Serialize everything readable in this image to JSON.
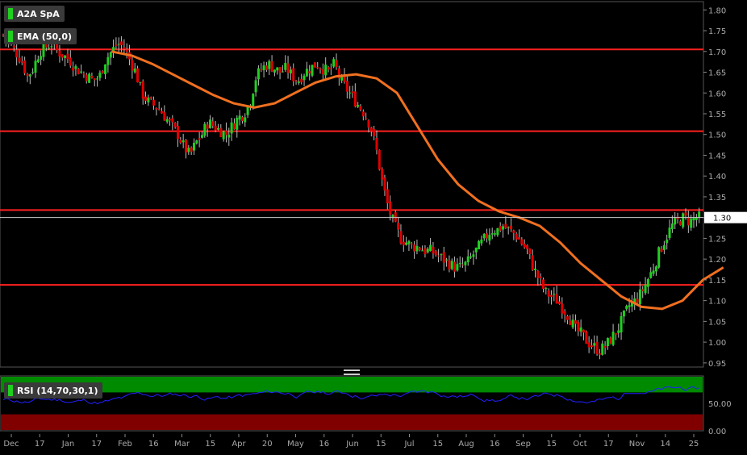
{
  "chart_data": [
    {
      "type": "candlestick",
      "title": "A2A SpA",
      "overlay": "EMA (50,0)",
      "y_ticks": [
        "1.80",
        "1.75",
        "1.70",
        "1.65",
        "1.60",
        "1.55",
        "1.50",
        "1.45",
        "1.40",
        "1.35",
        "1.30",
        "1.25",
        "1.20",
        "1.15",
        "1.10",
        "1.05",
        "1.00",
        "0.95"
      ],
      "ylim": [
        0.94,
        1.82
      ],
      "x_ticks": [
        "Dec",
        "17",
        "Jan",
        "17",
        "Feb",
        "16",
        "Mar",
        "15",
        "Apr",
        "20",
        "May",
        "16",
        "Jun",
        "15",
        "Jul",
        "15",
        "Aug",
        "16",
        "Sep",
        "15",
        "Oct",
        "17",
        "Nov",
        "14",
        "25"
      ],
      "last_price_label": "1.30",
      "last_price": 1.3,
      "horizontal_lines": [
        1.705,
        1.508,
        1.318,
        1.138
      ],
      "close_series": [
        1.74,
        1.72,
        1.7,
        1.68,
        1.64,
        1.66,
        1.7,
        1.71,
        1.72,
        1.7,
        1.69,
        1.68,
        1.66,
        1.65,
        1.64,
        1.63,
        1.64,
        1.68,
        1.7,
        1.72,
        1.71,
        1.68,
        1.65,
        1.6,
        1.58,
        1.57,
        1.56,
        1.54,
        1.52,
        1.5,
        1.47,
        1.45,
        1.48,
        1.5,
        1.53,
        1.52,
        1.51,
        1.5,
        1.52,
        1.54,
        1.55,
        1.58,
        1.64,
        1.66,
        1.67,
        1.66,
        1.65,
        1.66,
        1.64,
        1.63,
        1.65,
        1.66,
        1.67,
        1.66,
        1.65,
        1.67,
        1.63,
        1.61,
        1.59,
        1.57,
        1.55,
        1.52,
        1.46,
        1.38,
        1.32,
        1.28,
        1.25,
        1.24,
        1.23,
        1.23,
        1.22,
        1.22,
        1.21,
        1.2,
        1.19,
        1.18,
        1.18,
        1.19,
        1.21,
        1.23,
        1.25,
        1.27,
        1.27,
        1.28,
        1.27,
        1.26,
        1.24,
        1.22,
        1.18,
        1.15,
        1.12,
        1.11,
        1.1,
        1.08,
        1.06,
        1.03,
        1.02,
        1.0,
        0.99,
        0.98,
        0.99,
        1.01,
        1.03,
        1.06,
        1.09,
        1.1,
        1.12,
        1.15,
        1.18,
        1.22,
        1.25,
        1.28,
        1.29,
        1.3,
        1.29,
        1.3,
        1.3
      ],
      "ema_series": [
        1.7,
        1.69,
        1.67,
        1.645,
        1.62,
        1.595,
        1.575,
        1.565,
        1.575,
        1.6,
        1.625,
        1.64,
        1.645,
        1.635,
        1.6,
        1.52,
        1.44,
        1.38,
        1.34,
        1.315,
        1.3,
        1.28,
        1.24,
        1.19,
        1.15,
        1.11,
        1.085,
        1.08,
        1.1,
        1.15,
        1.18
      ],
      "ema_series_start_index": 14
    },
    {
      "type": "line",
      "title": "RSI (14,70,30,1)",
      "y_ticks": [
        "50.00",
        "0.00"
      ],
      "ylim": [
        0,
        100
      ],
      "overbought": 70,
      "oversold": 30
    }
  ],
  "colors": {
    "up": "#1fd01f",
    "down": "#e00000",
    "ema": "#f07020",
    "hline": "#ff2020",
    "rsi_line": "#2020ff",
    "rsi_top_band": "#008a00",
    "rsi_bottom_band": "#800000"
  }
}
